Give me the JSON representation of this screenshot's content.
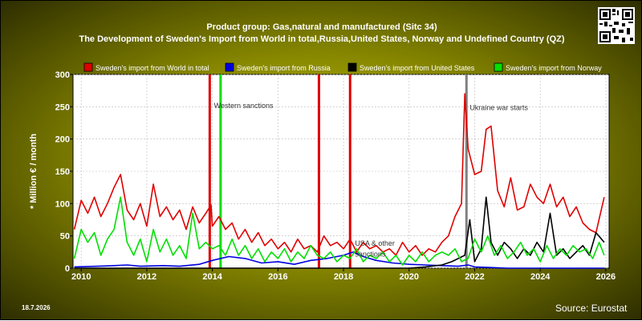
{
  "header": {
    "title_line1": "Product group: Gas,natural and manufactured (Sitc 34)",
    "title_line2": "The Development of Sweden's Import from World in total,Russia,United States, Norway and Undefined Country (QZ)"
  },
  "footer": {
    "date": "18.7.2026",
    "source": "Source: Eurostat"
  },
  "chart_data": {
    "type": "line",
    "title": "The Development of Sweden's Import from World in total,Russia,United States, Norway and Undefined Country (QZ)",
    "ylabel": "* Million € / month",
    "xlabel": "",
    "xlim": [
      2009.75,
      2026.1
    ],
    "ylim": [
      0,
      300
    ],
    "xticks": [
      2010,
      2012,
      2014,
      2016,
      2018,
      2020,
      2022,
      2024,
      2026
    ],
    "yticks": [
      0,
      50,
      100,
      150,
      200,
      250,
      300
    ],
    "grid": true,
    "legend_position": "top",
    "series": [
      {
        "name": "Sweden's import from World in total",
        "color": "#e00000",
        "x": [
          2009.79,
          2010.0,
          2010.2,
          2010.4,
          2010.6,
          2010.8,
          2011.0,
          2011.2,
          2011.4,
          2011.6,
          2011.8,
          2012.0,
          2012.2,
          2012.4,
          2012.6,
          2012.8,
          2013.0,
          2013.2,
          2013.4,
          2013.6,
          2013.8,
          2013.96,
          2014.0,
          2014.2,
          2014.4,
          2014.6,
          2014.8,
          2015.0,
          2015.2,
          2015.4,
          2015.6,
          2015.8,
          2016.0,
          2016.2,
          2016.4,
          2016.6,
          2016.8,
          2017.0,
          2017.2,
          2017.4,
          2017.6,
          2017.8,
          2018.0,
          2018.2,
          2018.4,
          2018.6,
          2018.8,
          2019.0,
          2019.2,
          2019.4,
          2019.6,
          2019.8,
          2020.0,
          2020.2,
          2020.4,
          2020.6,
          2020.8,
          2021.0,
          2021.2,
          2021.4,
          2021.6,
          2021.7,
          2021.8,
          2022.0,
          2022.2,
          2022.35,
          2022.5,
          2022.7,
          2022.9,
          2023.1,
          2023.3,
          2023.5,
          2023.7,
          2023.9,
          2024.1,
          2024.3,
          2024.5,
          2024.7,
          2024.9,
          2025.1,
          2025.3,
          2025.5,
          2025.7,
          2025.95
        ],
        "values": [
          60,
          105,
          85,
          110,
          80,
          100,
          125,
          145,
          90,
          75,
          100,
          65,
          130,
          80,
          95,
          75,
          90,
          60,
          95,
          70,
          85,
          98,
          65,
          80,
          60,
          70,
          45,
          60,
          40,
          55,
          35,
          45,
          30,
          40,
          25,
          45,
          30,
          35,
          25,
          50,
          35,
          40,
          30,
          45,
          25,
          40,
          30,
          35,
          25,
          30,
          20,
          40,
          25,
          35,
          20,
          30,
          25,
          40,
          50,
          80,
          100,
          270,
          185,
          145,
          150,
          215,
          220,
          120,
          95,
          140,
          90,
          95,
          130,
          110,
          100,
          130,
          95,
          110,
          80,
          95,
          70,
          60,
          55,
          110
        ]
      },
      {
        "name": "Sweden's import from Russia",
        "color": "#0000e0",
        "x": [
          2009.79,
          2010.5,
          2011.0,
          2011.4,
          2011.8,
          2012.5,
          2013.0,
          2013.6,
          2014.0,
          2014.5,
          2015.0,
          2015.5,
          2016.0,
          2016.5,
          2017.0,
          2017.5,
          2018.0,
          2018.3,
          2018.6,
          2019.0,
          2019.5,
          2020.0,
          2020.5,
          2021.0,
          2021.5,
          2021.8,
          2022.0,
          2022.5,
          2023.0,
          2024.0,
          2025.0,
          2025.95
        ],
        "values": [
          2,
          3,
          4,
          5,
          3,
          4,
          3,
          6,
          12,
          18,
          15,
          8,
          10,
          6,
          12,
          15,
          20,
          25,
          18,
          12,
          8,
          6,
          5,
          4,
          3,
          5,
          2,
          1,
          0,
          0,
          0,
          0
        ]
      },
      {
        "name": "Sweden's import from United States",
        "color": "#000000",
        "x": [
          2009.79,
          2014.0,
          2016.0,
          2018.0,
          2019.5,
          2020.0,
          2020.5,
          2021.0,
          2021.3,
          2021.5,
          2021.7,
          2021.85,
          2022.0,
          2022.2,
          2022.35,
          2022.5,
          2022.7,
          2022.9,
          2023.1,
          2023.3,
          2023.5,
          2023.7,
          2023.9,
          2024.1,
          2024.3,
          2024.5,
          2024.7,
          2024.9,
          2025.1,
          2025.3,
          2025.5,
          2025.7,
          2025.95
        ],
        "values": [
          0,
          0,
          0,
          0,
          0,
          0,
          2,
          5,
          10,
          15,
          20,
          75,
          10,
          30,
          110,
          40,
          20,
          40,
          30,
          15,
          30,
          20,
          40,
          25,
          85,
          20,
          30,
          15,
          25,
          35,
          20,
          55,
          40
        ]
      },
      {
        "name": "Sweden's import from Norway",
        "color": "#00e000",
        "x": [
          2009.79,
          2010.0,
          2010.2,
          2010.4,
          2010.6,
          2010.8,
          2011.0,
          2011.2,
          2011.4,
          2011.6,
          2011.8,
          2012.0,
          2012.2,
          2012.4,
          2012.6,
          2012.8,
          2013.0,
          2013.2,
          2013.4,
          2013.6,
          2013.8,
          2014.0,
          2014.2,
          2014.4,
          2014.6,
          2014.8,
          2015.0,
          2015.2,
          2015.4,
          2015.6,
          2015.8,
          2016.0,
          2016.2,
          2016.4,
          2016.6,
          2016.8,
          2017.0,
          2017.2,
          2017.4,
          2017.6,
          2017.8,
          2018.0,
          2018.2,
          2018.4,
          2018.6,
          2018.8,
          2019.0,
          2019.2,
          2019.4,
          2019.6,
          2019.8,
          2020.0,
          2020.2,
          2020.4,
          2020.6,
          2020.8,
          2021.0,
          2021.2,
          2021.4,
          2021.6,
          2021.8,
          2022.0,
          2022.2,
          2022.4,
          2022.6,
          2022.8,
          2023.0,
          2023.2,
          2023.4,
          2023.6,
          2023.8,
          2024.0,
          2024.2,
          2024.4,
          2024.6,
          2024.8,
          2025.0,
          2025.2,
          2025.4,
          2025.6,
          2025.8,
          2025.95
        ],
        "values": [
          15,
          60,
          40,
          55,
          20,
          45,
          60,
          110,
          40,
          20,
          45,
          10,
          60,
          25,
          45,
          20,
          35,
          15,
          85,
          30,
          40,
          30,
          35,
          20,
          45,
          20,
          35,
          15,
          30,
          10,
          25,
          15,
          30,
          10,
          25,
          15,
          35,
          20,
          15,
          25,
          10,
          20,
          15,
          30,
          10,
          20,
          15,
          25,
          10,
          20,
          5,
          20,
          10,
          25,
          10,
          20,
          25,
          20,
          30,
          10,
          15,
          45,
          25,
          50,
          20,
          35,
          15,
          25,
          40,
          20,
          30,
          10,
          35,
          15,
          30,
          20,
          35,
          25,
          30,
          15,
          40,
          20
        ]
      }
    ],
    "annotations": [
      {
        "text": "Western sanctions",
        "x": 2014.0,
        "y": 248
      },
      {
        "text": "Ukraine war starts",
        "x": 2021.8,
        "y": 245
      },
      {
        "text": "USA & other",
        "x": 2018.3,
        "y": 35
      },
      {
        "text": "sanctions",
        "x": 2018.3,
        "y": 18
      }
    ],
    "event_lines": [
      {
        "x": 2013.92,
        "color": "#e00000"
      },
      {
        "x": 2014.25,
        "color": "#00e000"
      },
      {
        "x": 2017.25,
        "color": "#e00000"
      },
      {
        "x": 2018.2,
        "color": "#e00000"
      },
      {
        "x": 2021.75,
        "color": "#808080"
      }
    ]
  }
}
